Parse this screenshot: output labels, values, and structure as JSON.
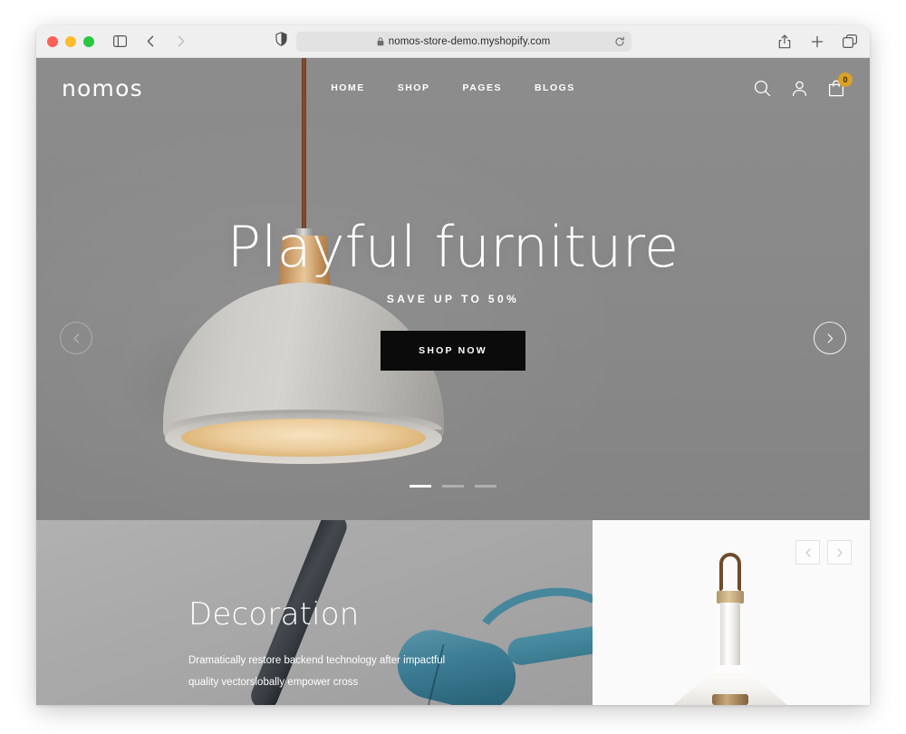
{
  "browser": {
    "traffic_lights": [
      "close",
      "minimize",
      "maximize"
    ],
    "sidebar_icon": "sidebar-icon",
    "back_icon": "chevron-left-icon",
    "forward_icon": "chevron-right-icon",
    "shield_icon": "privacy-shield-icon",
    "lock_icon": "lock-icon",
    "url": "nomos-store-demo.myshopify.com",
    "reload_icon": "reload-icon",
    "share_icon": "share-icon",
    "newtab_icon": "plus-icon",
    "tabs_icon": "tab-overview-icon"
  },
  "site": {
    "logo": "nomos",
    "nav": [
      {
        "label": "HOME"
      },
      {
        "label": "SHOP"
      },
      {
        "label": "PAGES"
      },
      {
        "label": "BLOGS"
      }
    ],
    "header_icons": {
      "search": "search-icon",
      "account": "user-icon",
      "cart": "cart-icon",
      "cart_count": "0",
      "cart_badge_color": "#d9a227"
    },
    "hero": {
      "title": "Playful furniture",
      "subtitle": "SAVE UP TO 50%",
      "cta": "SHOP NOW",
      "prev_icon": "chevron-left-icon",
      "next_icon": "chevron-right-icon",
      "slides": 3,
      "active_slide": 1,
      "background_color": "#8a8a8a",
      "image_alt": "grey dome pendant lamp with wooden top"
    },
    "decoration": {
      "title": "Decoration",
      "description": "Dramatically restore backend technology after impactful quality vectorslobally empower cross",
      "image_alt": "teal desk lamp arm with dark tube"
    },
    "product_panel": {
      "prev_icon": "chevron-left-icon",
      "next_icon": "chevron-right-icon",
      "image_alt": "white pendant lamp with leather strap",
      "background_color": "#fafafa"
    }
  }
}
